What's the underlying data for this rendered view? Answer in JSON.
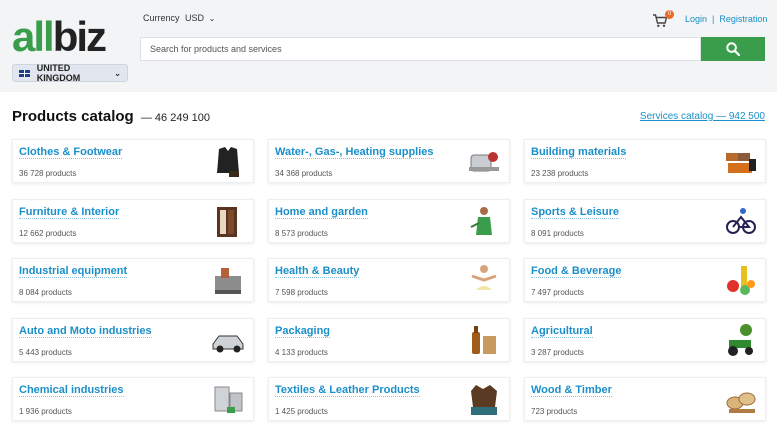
{
  "header": {
    "logo_text": "allbiz",
    "currency_label": "Currency",
    "currency_value": "USD",
    "region": "UNITED KINGDOM",
    "search_placeholder": "Search for products and services",
    "cart_count": "0",
    "login": "Login",
    "separator": "|",
    "registration": "Registration",
    "colors": {
      "brand_green": "#3a9d4b",
      "link_blue": "#1a8fc9",
      "badge_orange": "#e86a25"
    }
  },
  "main": {
    "title": "Products catalog",
    "total": "— 46 249 100",
    "services_link": "Services catalog — 942 500",
    "categories": [
      {
        "name": "Clothes & Footwear",
        "count": "36 728 products",
        "icon": "clothing-icon"
      },
      {
        "name": "Water-, Gas-, Heating supplies",
        "count": "34 368 products",
        "icon": "heating-icon"
      },
      {
        "name": "Building materials",
        "count": "23 238 products",
        "icon": "bricks-icon"
      },
      {
        "name": "Furniture & Interior",
        "count": "12 662 products",
        "icon": "wardrobe-icon"
      },
      {
        "name": "Home and garden",
        "count": "8 573 products",
        "icon": "gardener-icon"
      },
      {
        "name": "Sports & Leisure",
        "count": "8 091 products",
        "icon": "sport-icon"
      },
      {
        "name": "Industrial equipment",
        "count": "8 084 products",
        "icon": "machine-icon"
      },
      {
        "name": "Health & Beauty",
        "count": "7 598 products",
        "icon": "yoga-icon"
      },
      {
        "name": "Food & Beverage",
        "count": "7 497 products",
        "icon": "food-icon"
      },
      {
        "name": "Auto and Moto industries",
        "count": "5 443 products",
        "icon": "car-icon"
      },
      {
        "name": "Packaging",
        "count": "4 133 products",
        "icon": "bottle-bag-icon"
      },
      {
        "name": "Agricultural",
        "count": "3 287 products",
        "icon": "tractor-icon"
      },
      {
        "name": "Chemical industries",
        "count": "1 936 products",
        "icon": "chemical-tank-icon"
      },
      {
        "name": "Textiles & Leather Products",
        "count": "1 425 products",
        "icon": "leather-jacket-icon"
      },
      {
        "name": "Wood & Timber",
        "count": "723 products",
        "icon": "wood-icon"
      }
    ]
  }
}
